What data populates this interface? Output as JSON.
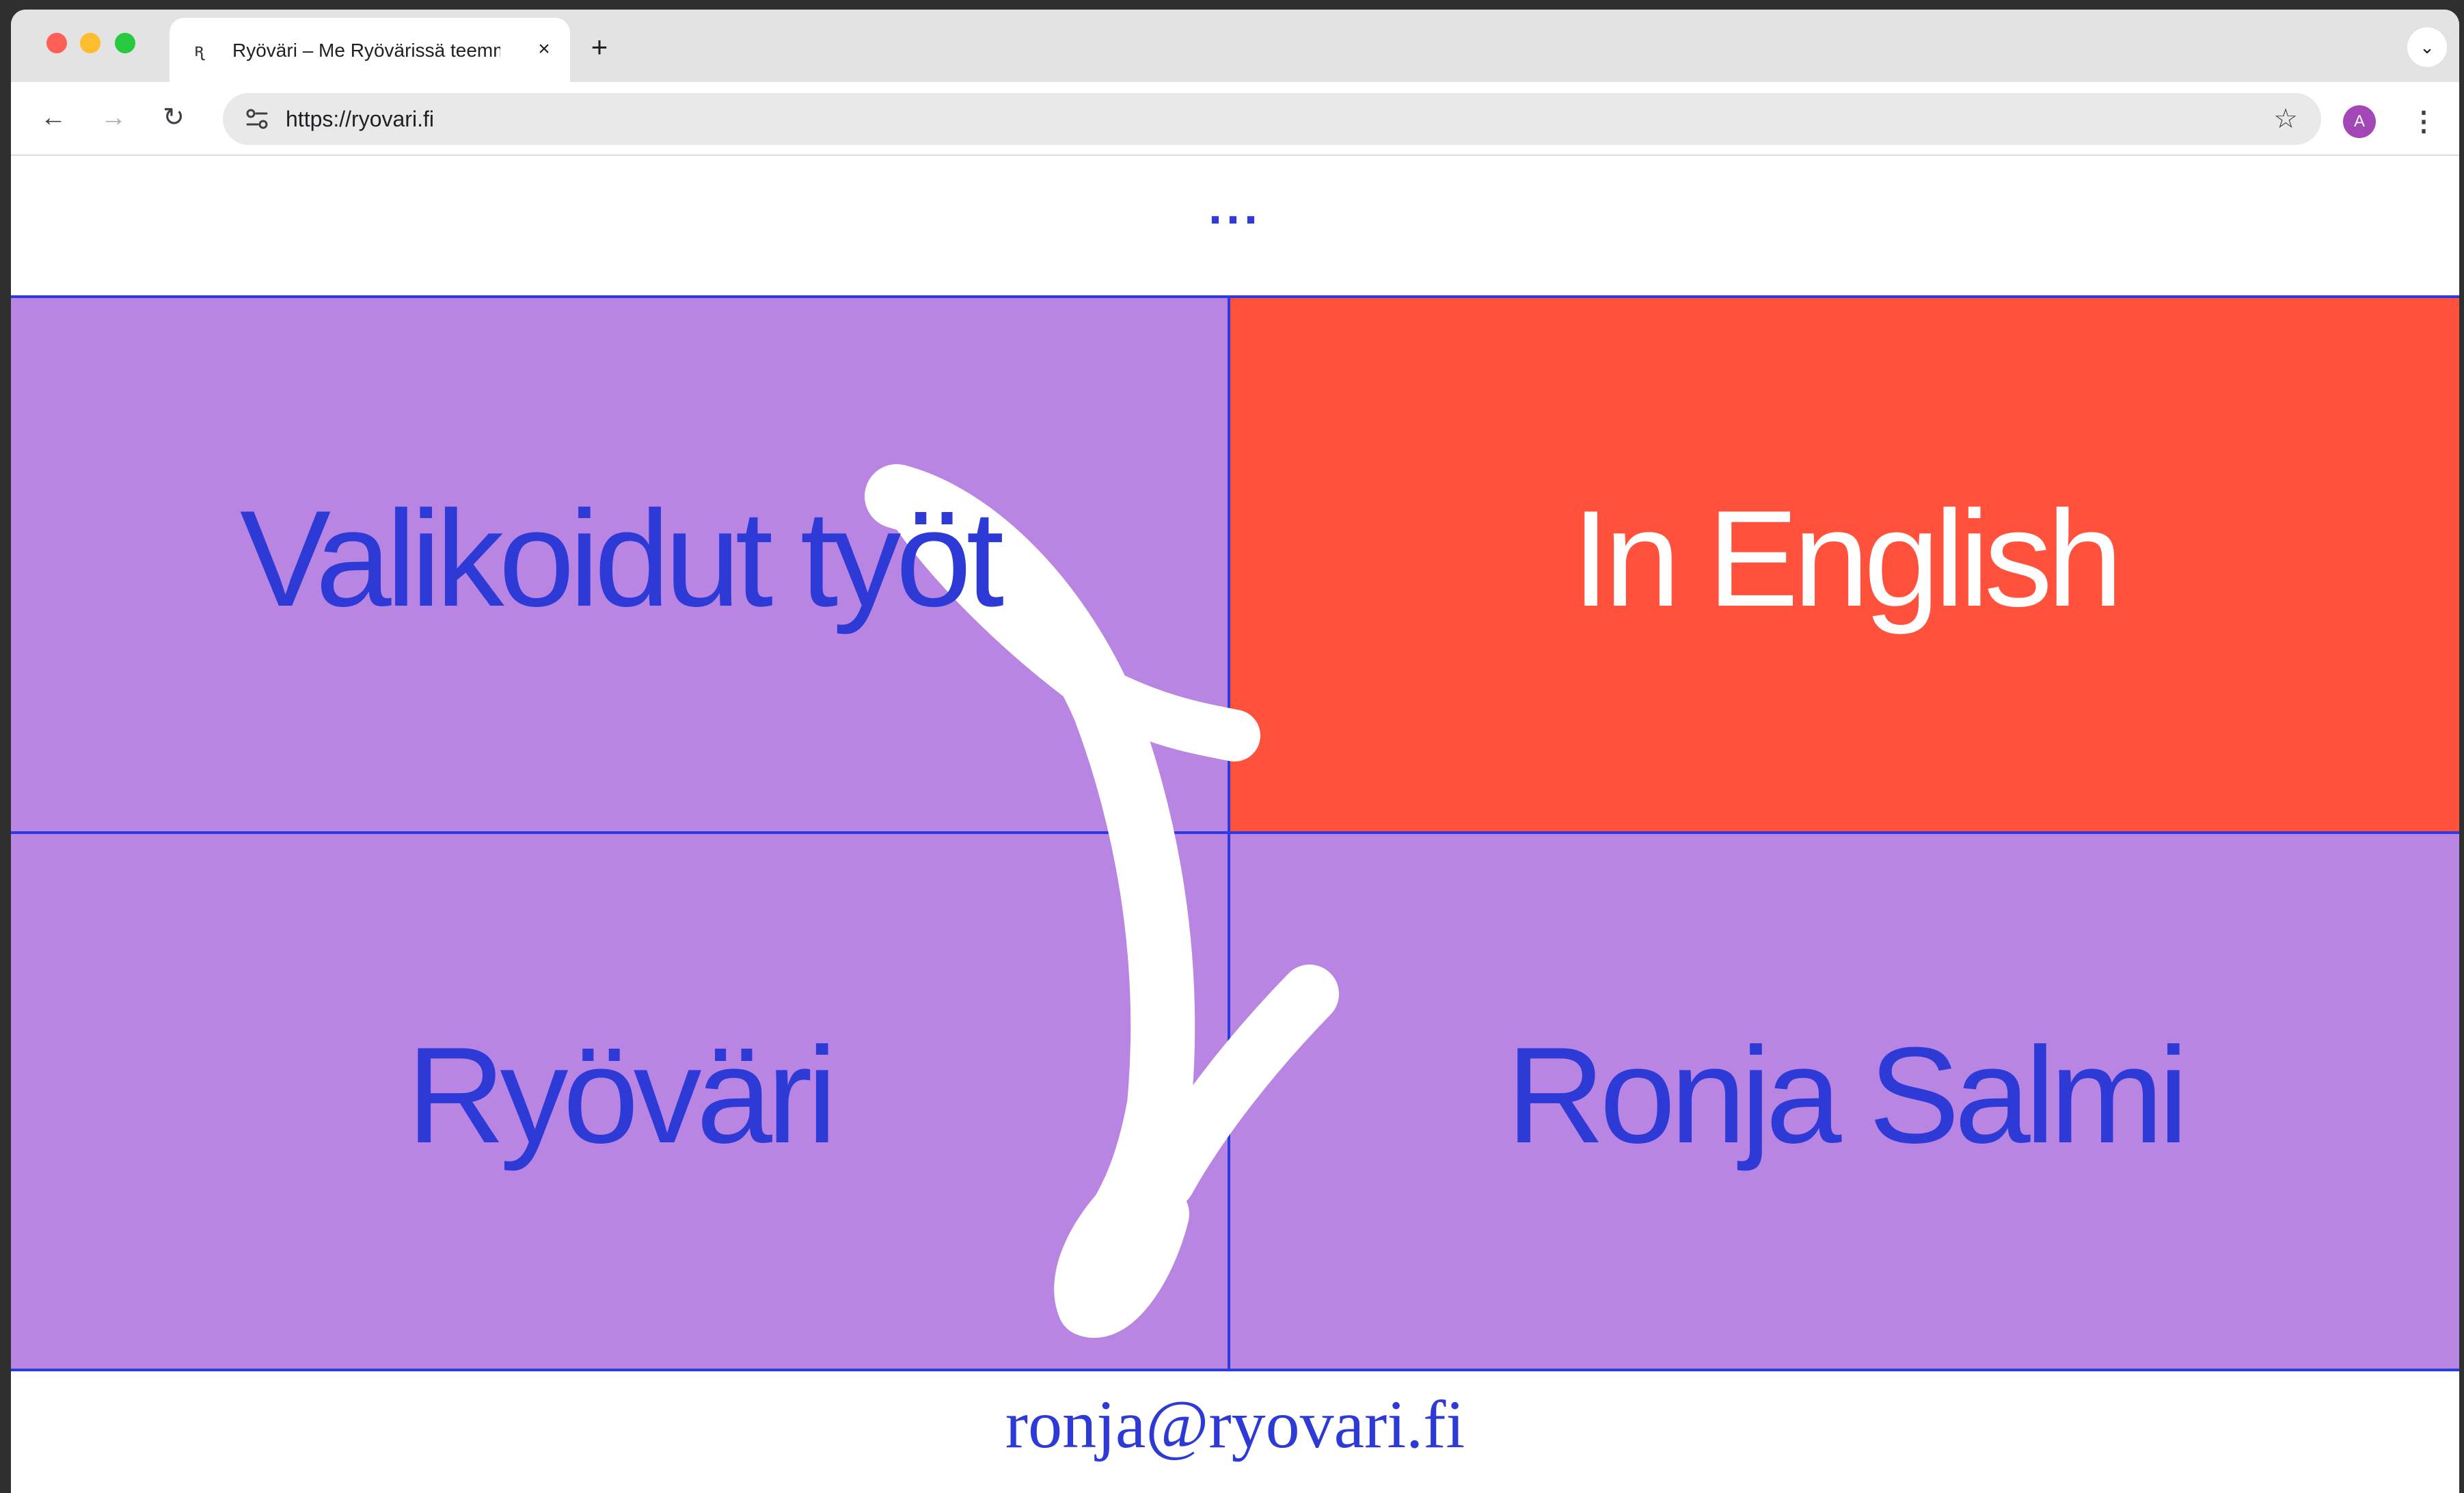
{
  "browser": {
    "tab": {
      "favicon": "ꭆ",
      "title": "Ryöväri – Me Ryövärissä teemme",
      "close_label": "×"
    },
    "new_tab_label": "+",
    "tab_menu_label": "⌄",
    "nav": {
      "back": "←",
      "forward": "→",
      "reload": "↻"
    },
    "url": "https://ryovari.fi",
    "bookmark_icon": "☆",
    "profile_initial": "A",
    "menu_label": "⋮",
    "colors": {
      "close": "#fe5f57",
      "minimize": "#febc2e",
      "zoom": "#28c840",
      "profile": "#a347b6"
    }
  },
  "page": {
    "menu_label": "...",
    "tiles": [
      {
        "label": "Valikoidut työt",
        "bg": "#b885e3",
        "fg": "#2d3ad6"
      },
      {
        "label": "In English",
        "bg": "#ff513c",
        "fg": "#ffffff"
      },
      {
        "label": "Ryöväri",
        "bg": "#b885e3",
        "fg": "#2d3ad6"
      },
      {
        "label": "Ronja Salmi",
        "bg": "#b885e3",
        "fg": "#2d3ad6"
      }
    ],
    "footer_email": "ronja@ryovari.fi",
    "colors": {
      "accent_blue": "#2d3ae0",
      "lilac": "#b885e3",
      "coral": "#ff513c",
      "logo_mark": "#ffffff"
    }
  }
}
